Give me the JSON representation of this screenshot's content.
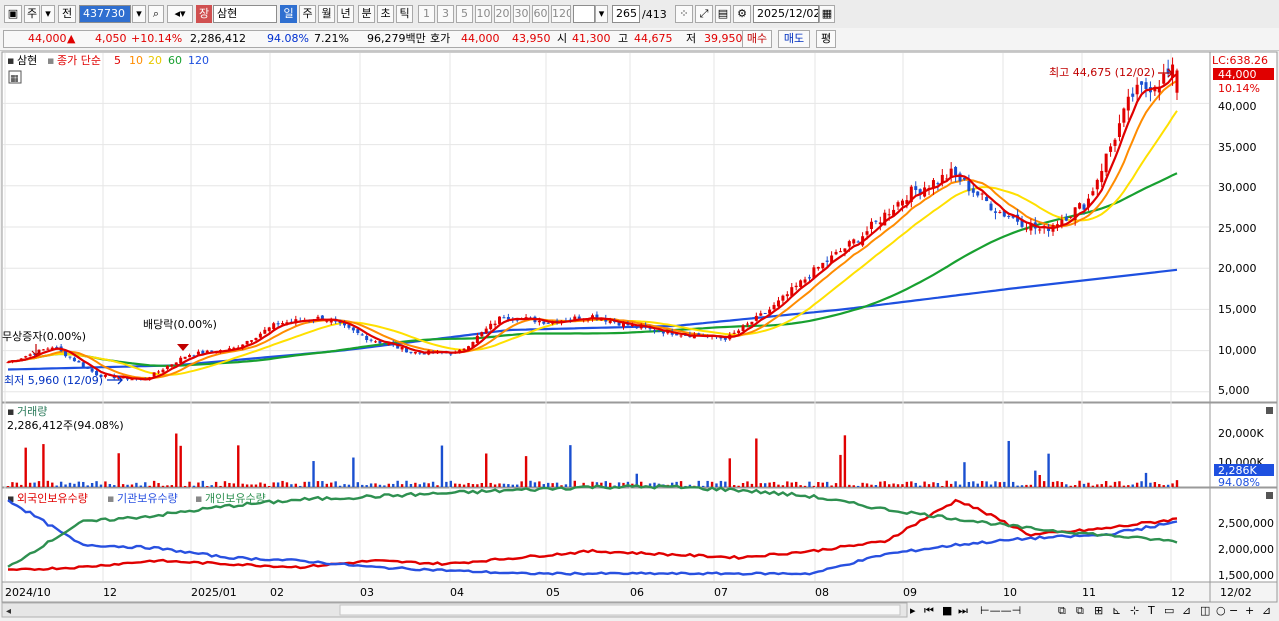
{
  "toolbar": {
    "type_label": "주",
    "prev_label": "전",
    "stock_code": "437730",
    "stock_badge": "장",
    "stock_name": "삼현",
    "periods": [
      "일",
      "주",
      "월",
      "년",
      "분",
      "초",
      "틱"
    ],
    "minutes": [
      "1",
      "3",
      "5",
      "10",
      "20",
      "30",
      "60",
      "120"
    ],
    "bar_count": "265",
    "bar_total": "/413",
    "date": "2025/12/02"
  },
  "quote": {
    "price": "44,000",
    "change": "4,050",
    "change_pct": "+10.14%",
    "volume": "2,286,412",
    "volume_ratio": "94.08%",
    "turnover": "7.21%",
    "amount": "96,279백만",
    "bid_label": "호가",
    "bid1": "44,000",
    "bid2": "43,950",
    "open_label": "시",
    "open": "41,300",
    "high_label": "고",
    "high": "44,675",
    "low_label": "저",
    "low": "39,950",
    "buy_label": "매수",
    "sell_label": "매도",
    "avg_label": "평"
  },
  "price_panel": {
    "name": "삼현",
    "ma_label": "종가 단순",
    "ma_periods": [
      "5",
      "10",
      "20",
      "60",
      "120"
    ],
    "lc_label": "LC:638.26",
    "last_price_label": "44,000",
    "last_pct_label": "10.14%",
    "high_note": "최고 44,675 (12/02)",
    "low_note": "최저 5,960 (12/09)",
    "event1": "무상증자(0.00%)",
    "event2": "배당락(0.00%)"
  },
  "volume_panel": {
    "title": "거래량",
    "value": "2,286,412주(94.08%)",
    "last_label": "2,286K",
    "pct_label": "94.08%"
  },
  "holding_panel": {
    "series_labels": [
      "외국인보유수량",
      "기관보유수량",
      "개인보유수량"
    ]
  },
  "x_labels": [
    "2024/10",
    "12",
    "2025/01",
    "02",
    "03",
    "04",
    "05",
    "06",
    "07",
    "08",
    "09",
    "10",
    "11",
    "12",
    "12/02"
  ],
  "colors": {
    "ma5": "#e00000",
    "ma10": "#ff8c00",
    "ma20": "#ffe000",
    "ma60": "#18a030",
    "ma120": "#1e50e0",
    "up": "#e00000",
    "down": "#1a4fd0",
    "foreign": "#e00000",
    "institution": "#2850e0",
    "individual": "#2e9050"
  },
  "chart_data": [
    {
      "type": "candlestick",
      "title": "삼현",
      "x_range": [
        "2024/10",
        "2025/12/02"
      ],
      "months": [
        "2024/10",
        "11",
        "12",
        "2025/01",
        "02",
        "03",
        "04",
        "05",
        "06",
        "07",
        "08",
        "09",
        "10",
        "11",
        "12"
      ],
      "ylim": [
        4000,
        46000
      ],
      "y_ticks": [
        "5,000",
        "10,000",
        "15,000",
        "20,000",
        "25,000",
        "30,000",
        "35,000",
        "40,000"
      ],
      "close_approx": [
        {
          "x": "2024/10",
          "y": 8600
        },
        {
          "x": "2024/10",
          "y": 10500
        },
        {
          "x": "2024/11",
          "y": 7000
        },
        {
          "x": "2024/12",
          "y": 6400
        },
        {
          "x": "2024/12",
          "y": 9500
        },
        {
          "x": "2025/01",
          "y": 10200
        },
        {
          "x": "2025/02",
          "y": 13300
        },
        {
          "x": "2025/03",
          "y": 14000
        },
        {
          "x": "2025/03",
          "y": 11500
        },
        {
          "x": "2025/04",
          "y": 9800
        },
        {
          "x": "2025/04",
          "y": 9700
        },
        {
          "x": "2025/05",
          "y": 14200
        },
        {
          "x": "2025/06",
          "y": 13500
        },
        {
          "x": "2025/07",
          "y": 14200
        },
        {
          "x": "2025/07",
          "y": 12800
        },
        {
          "x": "2025/08",
          "y": 12000
        },
        {
          "x": "2025/08",
          "y": 11500
        },
        {
          "x": "2025/09",
          "y": 15200
        },
        {
          "x": "2025/09",
          "y": 20000
        },
        {
          "x": "2025/10",
          "y": 24000
        },
        {
          "x": "2025/10",
          "y": 29000
        },
        {
          "x": "2025/11",
          "y": 31500
        },
        {
          "x": "2025/11",
          "y": 27000
        },
        {
          "x": "2025/11",
          "y": 24500
        },
        {
          "x": "2025/11",
          "y": 28000
        },
        {
          "x": "2025/12",
          "y": 41000
        },
        {
          "x": "2025/12/02",
          "y": 44000
        }
      ],
      "ma120_approx": [
        {
          "x": "2024/10",
          "y": 7700
        },
        {
          "x": "2025/01",
          "y": 8200
        },
        {
          "x": "2025/04",
          "y": 10000
        },
        {
          "x": "2025/07",
          "y": 12500
        },
        {
          "x": "2025/09",
          "y": 13000
        },
        {
          "x": "2025/10",
          "y": 15000
        },
        {
          "x": "2025/11",
          "y": 17500
        },
        {
          "x": "2025/12/02",
          "y": 19800
        }
      ]
    },
    {
      "type": "bar",
      "title": "거래량",
      "ylim": [
        0,
        25000000
      ],
      "y_ticks": [
        "10,000K",
        "20,000K"
      ],
      "last_value": 2286412
    },
    {
      "type": "line",
      "title": "보유수량",
      "ylim": [
        1400000,
        2800000
      ],
      "y_ticks": [
        "1,500,000",
        "2,000,000",
        "2,500,000"
      ],
      "series": [
        {
          "name": "외국인보유수량",
          "values": [
            1550000,
            1600000,
            1700000,
            1650000,
            1600000,
            1700000,
            1650000,
            1750000,
            1850000,
            1800000,
            1750000,
            1850000,
            2000000,
            2650000,
            2100000,
            2200000,
            2350000
          ]
        },
        {
          "name": "기관보유수량",
          "values": [
            2650000,
            1950000,
            1900000,
            1750000,
            1700000,
            1600000,
            1550000,
            1500000,
            1500000,
            1500000,
            1500000,
            1500000,
            1800000,
            1950000,
            2050000,
            2100000,
            2300000
          ]
        },
        {
          "name": "개인보유수량",
          "values": [
            1600000,
            2300000,
            2400000,
            2550000,
            2650000,
            2700000,
            2750000,
            2800000,
            2850000,
            2850000,
            2800000,
            2700000,
            2500000,
            2350000,
            2200000,
            2100000,
            2000000
          ]
        }
      ]
    }
  ]
}
